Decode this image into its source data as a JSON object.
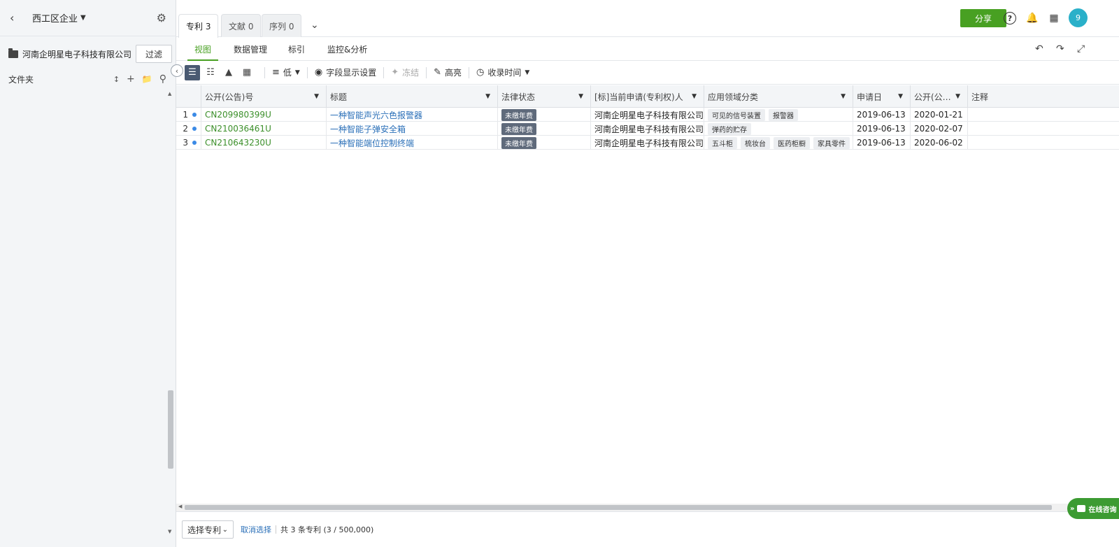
{
  "sidebar": {
    "title": "西工区企业",
    "company": "河南企明星电子科技有限公司",
    "filter_label": "过滤",
    "folders_label": "文件夹"
  },
  "tabs": [
    {
      "label": "专利 3",
      "active": true
    },
    {
      "label": "文献 0",
      "active": false
    },
    {
      "label": "序列 0",
      "active": false
    }
  ],
  "header": {
    "share_label": "分享",
    "avatar_text": "9"
  },
  "subtabs": [
    {
      "label": "视图",
      "active": true
    },
    {
      "label": "数据管理",
      "active": false
    },
    {
      "label": "标引",
      "active": false
    },
    {
      "label": "监控&分析",
      "active": false
    }
  ],
  "toolbar": {
    "density_label": "低",
    "fields_label": "字段显示设置",
    "freeze_label": "冻结",
    "highlight_label": "高亮",
    "sort_label": "收录时间"
  },
  "table": {
    "columns": [
      "公开(公告)号",
      "标题",
      "法律状态",
      "[标]当前申请(专利权)人",
      "应用领域分类",
      "申请日",
      "公开(公…",
      "注释"
    ],
    "rows": [
      {
        "num": "1",
        "pn": "CN209980399U",
        "title": "一种智能声光六色报警器",
        "status": "未缴年费",
        "applicant": "河南企明星电子科技有限公司",
        "tags": [
          "可见的信号装置",
          "报警器"
        ],
        "app_date": "2019-06-13",
        "pub_date": "2020-01-21"
      },
      {
        "num": "2",
        "pn": "CN210036461U",
        "title": "一种智能子弹安全箱",
        "status": "未缴年费",
        "applicant": "河南企明星电子科技有限公司",
        "tags": [
          "弹药的贮存"
        ],
        "app_date": "2019-06-13",
        "pub_date": "2020-02-07"
      },
      {
        "num": "3",
        "pn": "CN210643230U",
        "title": "一种智能端位控制终端",
        "status": "未缴年费",
        "applicant": "河南企明星电子科技有限公司",
        "tags": [
          "五斗柜",
          "梳妆台",
          "医药柜橱",
          "家具零件"
        ],
        "app_date": "2019-06-13",
        "pub_date": "2020-06-02"
      }
    ]
  },
  "footer": {
    "select_label": "选择专利",
    "cancel_label": "取消选择",
    "count_text": "共 3 条专利 (3 / 500,000)"
  },
  "chat": {
    "label": "在线咨询"
  }
}
